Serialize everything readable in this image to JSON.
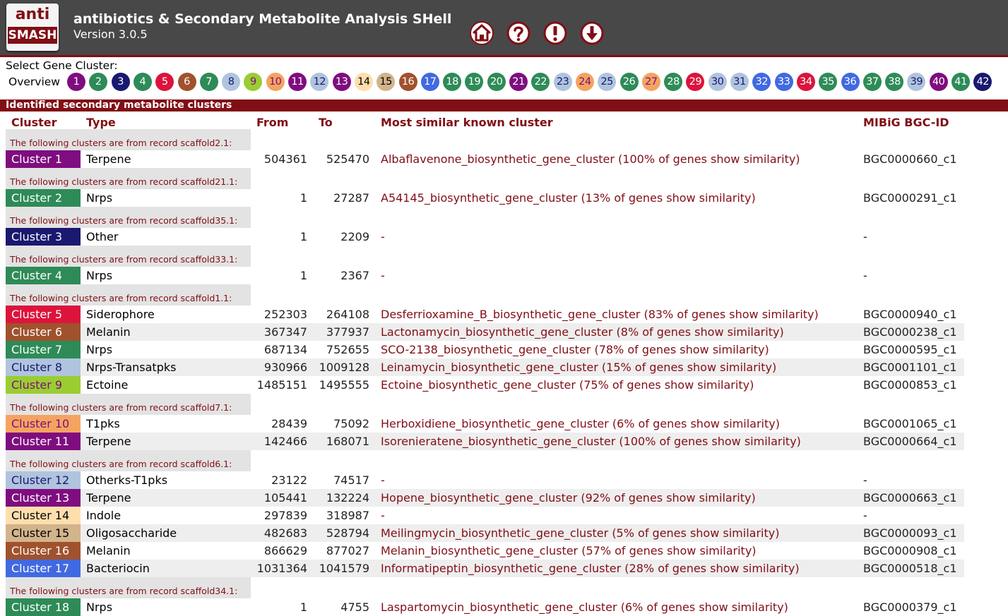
{
  "app": {
    "logo_top": "anti",
    "logo_bottom": "SMASH",
    "title": "antibiotics & Secondary Metabolite Analysis SHell",
    "version": "Version 3.0.5"
  },
  "toolbar": {
    "icons": [
      "home-icon",
      "help-icon",
      "alert-icon",
      "download-icon"
    ]
  },
  "cluster_select": {
    "label": "Select Gene Cluster:",
    "overview": "Overview",
    "clusters": [
      {
        "n": "1",
        "bg": "#7f0d7f",
        "fg": "#ffffff"
      },
      {
        "n": "2",
        "bg": "#2e8b57",
        "fg": "#ffffff"
      },
      {
        "n": "3",
        "bg": "#191970",
        "fg": "#ffffff"
      },
      {
        "n": "4",
        "bg": "#2e8b57",
        "fg": "#ffffff"
      },
      {
        "n": "5",
        "bg": "#dc143c",
        "fg": "#ffffff"
      },
      {
        "n": "6",
        "bg": "#a0522d",
        "fg": "#ffffff"
      },
      {
        "n": "7",
        "bg": "#2e8b57",
        "fg": "#ffffff"
      },
      {
        "n": "8",
        "bg": "#b0c4de",
        "fg": "#191970"
      },
      {
        "n": "9",
        "bg": "#9acd32",
        "fg": "#7f0d7f"
      },
      {
        "n": "10",
        "bg": "#f4a460",
        "fg": "#7f0d7f"
      },
      {
        "n": "11",
        "bg": "#7f0d7f",
        "fg": "#ffffff"
      },
      {
        "n": "12",
        "bg": "#b0c4de",
        "fg": "#191970"
      },
      {
        "n": "13",
        "bg": "#7f0d7f",
        "fg": "#ffffff"
      },
      {
        "n": "14",
        "bg": "#ffdead",
        "fg": "#000000"
      },
      {
        "n": "15",
        "bg": "#d2b48c",
        "fg": "#000000"
      },
      {
        "n": "16",
        "bg": "#a0522d",
        "fg": "#ffffff"
      },
      {
        "n": "17",
        "bg": "#4169e1",
        "fg": "#ffffff"
      },
      {
        "n": "18",
        "bg": "#2e8b57",
        "fg": "#ffffff"
      },
      {
        "n": "19",
        "bg": "#2e8b57",
        "fg": "#ffffff"
      },
      {
        "n": "20",
        "bg": "#2e8b57",
        "fg": "#ffffff"
      },
      {
        "n": "21",
        "bg": "#7f0d7f",
        "fg": "#ffffff"
      },
      {
        "n": "22",
        "bg": "#2e8b57",
        "fg": "#ffffff"
      },
      {
        "n": "23",
        "bg": "#b0c4de",
        "fg": "#191970"
      },
      {
        "n": "24",
        "bg": "#f4a460",
        "fg": "#7f0d7f"
      },
      {
        "n": "25",
        "bg": "#b0c4de",
        "fg": "#191970"
      },
      {
        "n": "26",
        "bg": "#2e8b57",
        "fg": "#ffffff"
      },
      {
        "n": "27",
        "bg": "#f4a460",
        "fg": "#7f0d7f"
      },
      {
        "n": "28",
        "bg": "#2e8b57",
        "fg": "#ffffff"
      },
      {
        "n": "29",
        "bg": "#dc143c",
        "fg": "#ffffff"
      },
      {
        "n": "30",
        "bg": "#b0c4de",
        "fg": "#191970"
      },
      {
        "n": "31",
        "bg": "#b0c4de",
        "fg": "#191970"
      },
      {
        "n": "32",
        "bg": "#4169e1",
        "fg": "#ffffff"
      },
      {
        "n": "33",
        "bg": "#4169e1",
        "fg": "#ffffff"
      },
      {
        "n": "34",
        "bg": "#dc143c",
        "fg": "#ffffff"
      },
      {
        "n": "35",
        "bg": "#2e8b57",
        "fg": "#ffffff"
      },
      {
        "n": "36",
        "bg": "#4169e1",
        "fg": "#ffffff"
      },
      {
        "n": "37",
        "bg": "#2e8b57",
        "fg": "#ffffff"
      },
      {
        "n": "38",
        "bg": "#2e8b57",
        "fg": "#ffffff"
      },
      {
        "n": "39",
        "bg": "#b0c4de",
        "fg": "#191970"
      },
      {
        "n": "40",
        "bg": "#7f0d7f",
        "fg": "#ffffff"
      },
      {
        "n": "41",
        "bg": "#2e8b57",
        "fg": "#ffffff"
      },
      {
        "n": "42",
        "bg": "#191970",
        "fg": "#ffffff"
      }
    ]
  },
  "section_title": "Identified secondary metabolite clusters",
  "table": {
    "headers": {
      "cluster": "Cluster",
      "type": "Type",
      "from": "From",
      "to": "To",
      "similar": "Most similar known cluster",
      "mibig": "MIBiG BGC-ID"
    },
    "groups": [
      {
        "record": "The following clusters are from record scaffold2.1:",
        "rows": [
          {
            "cluster": "Cluster 1",
            "bg": "#7f0d7f",
            "fg": "#ffffff",
            "type": "Terpene",
            "from": "504361",
            "to": "525470",
            "similar": "Albaflavenone_biosynthetic_gene_cluster (100% of genes show similarity)",
            "mibig": "BGC0000660_c1"
          }
        ]
      },
      {
        "record": "The following clusters are from record scaffold21.1:",
        "rows": [
          {
            "cluster": "Cluster 2",
            "bg": "#2e8b57",
            "fg": "#ffffff",
            "type": "Nrps",
            "from": "1",
            "to": "27287",
            "similar": "A54145_biosynthetic_gene_cluster (13% of genes show similarity)",
            "mibig": "BGC0000291_c1"
          }
        ]
      },
      {
        "record": "The following clusters are from record scaffold35.1:",
        "rows": [
          {
            "cluster": "Cluster 3",
            "bg": "#191970",
            "fg": "#ffffff",
            "type": "Other",
            "from": "1",
            "to": "2209",
            "similar": "-",
            "mibig": "-"
          }
        ]
      },
      {
        "record": "The following clusters are from record scaffold33.1:",
        "rows": [
          {
            "cluster": "Cluster 4",
            "bg": "#2e8b57",
            "fg": "#ffffff",
            "type": "Nrps",
            "from": "1",
            "to": "2367",
            "similar": "-",
            "mibig": "-"
          }
        ]
      },
      {
        "record": "The following clusters are from record scaffold1.1:",
        "rows": [
          {
            "cluster": "Cluster 5",
            "bg": "#dc143c",
            "fg": "#ffffff",
            "type": "Siderophore",
            "from": "252303",
            "to": "264108",
            "similar": "Desferrioxamine_B_biosynthetic_gene_cluster (83% of genes show similarity)",
            "mibig": "BGC0000940_c1"
          },
          {
            "cluster": "Cluster 6",
            "bg": "#a0522d",
            "fg": "#ffffff",
            "type": "Melanin",
            "from": "367347",
            "to": "377937",
            "similar": "Lactonamycin_biosynthetic_gene_cluster (8% of genes show similarity)",
            "mibig": "BGC0000238_c1"
          },
          {
            "cluster": "Cluster 7",
            "bg": "#2e8b57",
            "fg": "#ffffff",
            "type": "Nrps",
            "from": "687134",
            "to": "752655",
            "similar": "SCO-2138_biosynthetic_gene_cluster (78% of genes show similarity)",
            "mibig": "BGC0000595_c1"
          },
          {
            "cluster": "Cluster 8",
            "bg": "#b0c4de",
            "fg": "#191970",
            "type": "Nrps-Transatpks",
            "from": "930966",
            "to": "1009128",
            "similar": "Leinamycin_biosynthetic_gene_cluster (15% of genes show similarity)",
            "mibig": "BGC0001101_c1"
          },
          {
            "cluster": "Cluster 9",
            "bg": "#9acd32",
            "fg": "#7f0d7f",
            "type": "Ectoine",
            "from": "1485151",
            "to": "1495555",
            "similar": "Ectoine_biosynthetic_gene_cluster (75% of genes show similarity)",
            "mibig": "BGC0000853_c1"
          }
        ]
      },
      {
        "record": "The following clusters are from record scaffold7.1:",
        "rows": [
          {
            "cluster": "Cluster 10",
            "bg": "#f4a460",
            "fg": "#7f0d7f",
            "type": "T1pks",
            "from": "28439",
            "to": "75092",
            "similar": "Herboxidiene_biosynthetic_gene_cluster (6% of genes show similarity)",
            "mibig": "BGC0001065_c1"
          },
          {
            "cluster": "Cluster 11",
            "bg": "#7f0d7f",
            "fg": "#ffffff",
            "type": "Terpene",
            "from": "142466",
            "to": "168071",
            "similar": "Isorenieratene_biosynthetic_gene_cluster (100% of genes show similarity)",
            "mibig": "BGC0000664_c1"
          }
        ]
      },
      {
        "record": "The following clusters are from record scaffold6.1:",
        "rows": [
          {
            "cluster": "Cluster 12",
            "bg": "#b0c4de",
            "fg": "#191970",
            "type": "Otherks-T1pks",
            "from": "23122",
            "to": "74517",
            "similar": "-",
            "mibig": "-"
          },
          {
            "cluster": "Cluster 13",
            "bg": "#7f0d7f",
            "fg": "#ffffff",
            "type": "Terpene",
            "from": "105441",
            "to": "132224",
            "similar": "Hopene_biosynthetic_gene_cluster (92% of genes show similarity)",
            "mibig": "BGC0000663_c1"
          },
          {
            "cluster": "Cluster 14",
            "bg": "#ffdead",
            "fg": "#000000",
            "type": "Indole",
            "from": "297839",
            "to": "318987",
            "similar": "-",
            "mibig": "-"
          },
          {
            "cluster": "Cluster 15",
            "bg": "#d2b48c",
            "fg": "#000000",
            "type": "Oligosaccharide",
            "from": "482683",
            "to": "528794",
            "similar": "Meilingmycin_biosynthetic_gene_cluster (5% of genes show similarity)",
            "mibig": "BGC0000093_c1"
          },
          {
            "cluster": "Cluster 16",
            "bg": "#a0522d",
            "fg": "#ffffff",
            "type": "Melanin",
            "from": "866629",
            "to": "877027",
            "similar": "Melanin_biosynthetic_gene_cluster (57% of genes show similarity)",
            "mibig": "BGC0000908_c1"
          },
          {
            "cluster": "Cluster 17",
            "bg": "#4169e1",
            "fg": "#ffffff",
            "type": "Bacteriocin",
            "from": "1031364",
            "to": "1041579",
            "similar": "Informatipeptin_biosynthetic_gene_cluster (28% of genes show similarity)",
            "mibig": "BGC0000518_c1"
          }
        ]
      },
      {
        "record": "The following clusters are from record scaffold34.1:",
        "rows": [
          {
            "cluster": "Cluster 18",
            "bg": "#2e8b57",
            "fg": "#ffffff",
            "type": "Nrps",
            "from": "1",
            "to": "4755",
            "similar": "Laspartomycin_biosynthetic_gene_cluster (6% of genes show similarity)",
            "mibig": "BGC0000379_c1"
          }
        ]
      }
    ]
  }
}
